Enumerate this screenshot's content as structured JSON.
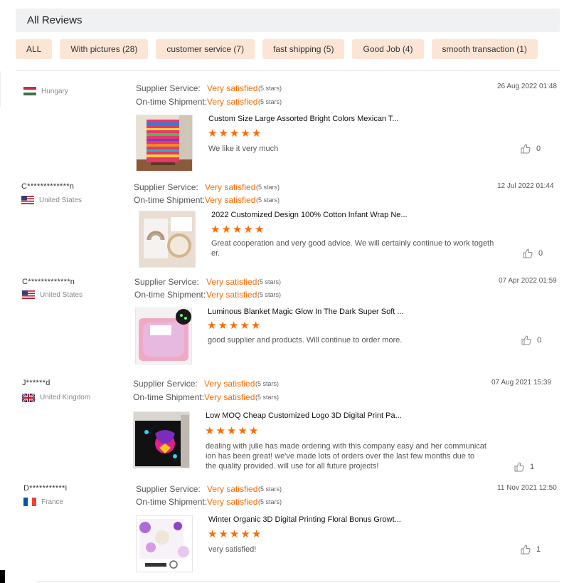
{
  "header": {
    "title": "All Reviews"
  },
  "filters": [
    {
      "label": "ALL"
    },
    {
      "label": "With pictures (28)"
    },
    {
      "label": "customer service (7)"
    },
    {
      "label": "fast shipping (5)"
    },
    {
      "label": "Good Job (4)"
    },
    {
      "label": "smooth transaction (1)"
    }
  ],
  "labels": {
    "supplier_service": "Supplier Service:",
    "ontime_shipment": "On-time Shipment:"
  },
  "reviews": [
    {
      "name": "",
      "country": "Hungary",
      "flag_icon": "hungary-flag-icon",
      "supplier_value": "Very satisfied",
      "supplier_stars": "(5 stars)",
      "shipment_value": "Very satisfied",
      "shipment_stars": "(5 stars)",
      "date": "26 Aug 2022 01:48",
      "product_title": "Custom Size Large Assorted Bright Colors Mexican T...",
      "rating": 5,
      "comment": "We like it very much",
      "likes": "0"
    },
    {
      "name": "C*************n",
      "country": "United States",
      "flag_icon": "usa-flag-icon",
      "supplier_value": "Very satisfied",
      "supplier_stars": "(5 stars)",
      "shipment_value": "Very satisfied",
      "shipment_stars": "(5 stars)",
      "date": "12 Jul 2022 01:44",
      "product_title": "2022 Customized Design 100% Cotton Infant Wrap Ne...",
      "rating": 5,
      "comment": "Great cooperation and very good advice. We will certainly continue to work togeth er.",
      "likes": "0"
    },
    {
      "name": "C*************n",
      "country": "United States",
      "flag_icon": "usa-flag-icon",
      "supplier_value": "Very satisfied",
      "supplier_stars": "(5 stars)",
      "shipment_value": "Very satisfied",
      "shipment_stars": "(5 stars)",
      "date": "07 Apr 2022 01:59",
      "product_title": "Luminous Blanket Magic Glow In The Dark Super Soft ...",
      "rating": 5,
      "comment": "good supplier and products. Will continue to order more.",
      "likes": "0"
    },
    {
      "name": "J******d",
      "country": "United Kingdom",
      "flag_icon": "uk-flag-icon",
      "supplier_value": "Very satisfied",
      "supplier_stars": "(5 stars)",
      "shipment_value": "Very satisfied",
      "shipment_stars": "(5 stars)",
      "date": "07 Aug 2021 15:39",
      "product_title": "Low MOQ Cheap Customized Logo 3D Digital Print Pa...",
      "rating": 5,
      "comment": "dealing with julie has made ordering with this company easy and her communicat ion has been great! we've made lots of orders over the last few months due to the quality provided. will use for all future projects!",
      "likes": "1"
    },
    {
      "name": "D***********i",
      "country": "France",
      "flag_icon": "france-flag-icon",
      "supplier_value": "Very satisfied",
      "supplier_stars": "(5 stars)",
      "shipment_value": "Very satisfied",
      "shipment_stars": "(5 stars)",
      "date": "11 Nov 2021 12:50",
      "product_title": "Winter Organic 3D Digital Printing Floral Bonus Growt...",
      "rating": 5,
      "comment": "very satisfied!",
      "likes": "1"
    }
  ]
}
